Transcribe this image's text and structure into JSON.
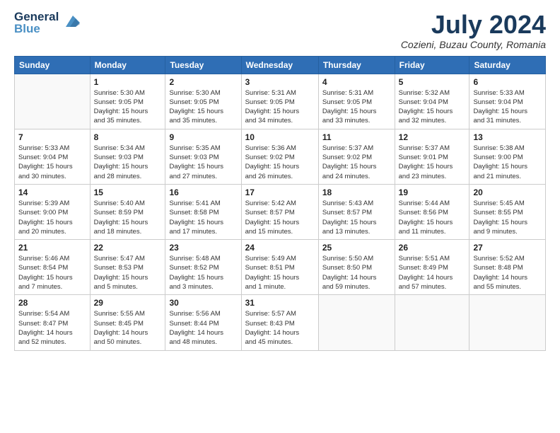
{
  "logo": {
    "line1": "General",
    "line2": "Blue"
  },
  "title": "July 2024",
  "location": "Cozieni, Buzau County, Romania",
  "days_of_week": [
    "Sunday",
    "Monday",
    "Tuesday",
    "Wednesday",
    "Thursday",
    "Friday",
    "Saturday"
  ],
  "weeks": [
    [
      {
        "day": "",
        "info": ""
      },
      {
        "day": "1",
        "info": "Sunrise: 5:30 AM\nSunset: 9:05 PM\nDaylight: 15 hours\nand 35 minutes."
      },
      {
        "day": "2",
        "info": "Sunrise: 5:30 AM\nSunset: 9:05 PM\nDaylight: 15 hours\nand 35 minutes."
      },
      {
        "day": "3",
        "info": "Sunrise: 5:31 AM\nSunset: 9:05 PM\nDaylight: 15 hours\nand 34 minutes."
      },
      {
        "day": "4",
        "info": "Sunrise: 5:31 AM\nSunset: 9:05 PM\nDaylight: 15 hours\nand 33 minutes."
      },
      {
        "day": "5",
        "info": "Sunrise: 5:32 AM\nSunset: 9:04 PM\nDaylight: 15 hours\nand 32 minutes."
      },
      {
        "day": "6",
        "info": "Sunrise: 5:33 AM\nSunset: 9:04 PM\nDaylight: 15 hours\nand 31 minutes."
      }
    ],
    [
      {
        "day": "7",
        "info": "Sunrise: 5:33 AM\nSunset: 9:04 PM\nDaylight: 15 hours\nand 30 minutes."
      },
      {
        "day": "8",
        "info": "Sunrise: 5:34 AM\nSunset: 9:03 PM\nDaylight: 15 hours\nand 28 minutes."
      },
      {
        "day": "9",
        "info": "Sunrise: 5:35 AM\nSunset: 9:03 PM\nDaylight: 15 hours\nand 27 minutes."
      },
      {
        "day": "10",
        "info": "Sunrise: 5:36 AM\nSunset: 9:02 PM\nDaylight: 15 hours\nand 26 minutes."
      },
      {
        "day": "11",
        "info": "Sunrise: 5:37 AM\nSunset: 9:02 PM\nDaylight: 15 hours\nand 24 minutes."
      },
      {
        "day": "12",
        "info": "Sunrise: 5:37 AM\nSunset: 9:01 PM\nDaylight: 15 hours\nand 23 minutes."
      },
      {
        "day": "13",
        "info": "Sunrise: 5:38 AM\nSunset: 9:00 PM\nDaylight: 15 hours\nand 21 minutes."
      }
    ],
    [
      {
        "day": "14",
        "info": "Sunrise: 5:39 AM\nSunset: 9:00 PM\nDaylight: 15 hours\nand 20 minutes."
      },
      {
        "day": "15",
        "info": "Sunrise: 5:40 AM\nSunset: 8:59 PM\nDaylight: 15 hours\nand 18 minutes."
      },
      {
        "day": "16",
        "info": "Sunrise: 5:41 AM\nSunset: 8:58 PM\nDaylight: 15 hours\nand 17 minutes."
      },
      {
        "day": "17",
        "info": "Sunrise: 5:42 AM\nSunset: 8:57 PM\nDaylight: 15 hours\nand 15 minutes."
      },
      {
        "day": "18",
        "info": "Sunrise: 5:43 AM\nSunset: 8:57 PM\nDaylight: 15 hours\nand 13 minutes."
      },
      {
        "day": "19",
        "info": "Sunrise: 5:44 AM\nSunset: 8:56 PM\nDaylight: 15 hours\nand 11 minutes."
      },
      {
        "day": "20",
        "info": "Sunrise: 5:45 AM\nSunset: 8:55 PM\nDaylight: 15 hours\nand 9 minutes."
      }
    ],
    [
      {
        "day": "21",
        "info": "Sunrise: 5:46 AM\nSunset: 8:54 PM\nDaylight: 15 hours\nand 7 minutes."
      },
      {
        "day": "22",
        "info": "Sunrise: 5:47 AM\nSunset: 8:53 PM\nDaylight: 15 hours\nand 5 minutes."
      },
      {
        "day": "23",
        "info": "Sunrise: 5:48 AM\nSunset: 8:52 PM\nDaylight: 15 hours\nand 3 minutes."
      },
      {
        "day": "24",
        "info": "Sunrise: 5:49 AM\nSunset: 8:51 PM\nDaylight: 15 hours\nand 1 minute."
      },
      {
        "day": "25",
        "info": "Sunrise: 5:50 AM\nSunset: 8:50 PM\nDaylight: 14 hours\nand 59 minutes."
      },
      {
        "day": "26",
        "info": "Sunrise: 5:51 AM\nSunset: 8:49 PM\nDaylight: 14 hours\nand 57 minutes."
      },
      {
        "day": "27",
        "info": "Sunrise: 5:52 AM\nSunset: 8:48 PM\nDaylight: 14 hours\nand 55 minutes."
      }
    ],
    [
      {
        "day": "28",
        "info": "Sunrise: 5:54 AM\nSunset: 8:47 PM\nDaylight: 14 hours\nand 52 minutes."
      },
      {
        "day": "29",
        "info": "Sunrise: 5:55 AM\nSunset: 8:45 PM\nDaylight: 14 hours\nand 50 minutes."
      },
      {
        "day": "30",
        "info": "Sunrise: 5:56 AM\nSunset: 8:44 PM\nDaylight: 14 hours\nand 48 minutes."
      },
      {
        "day": "31",
        "info": "Sunrise: 5:57 AM\nSunset: 8:43 PM\nDaylight: 14 hours\nand 45 minutes."
      },
      {
        "day": "",
        "info": ""
      },
      {
        "day": "",
        "info": ""
      },
      {
        "day": "",
        "info": ""
      }
    ]
  ]
}
